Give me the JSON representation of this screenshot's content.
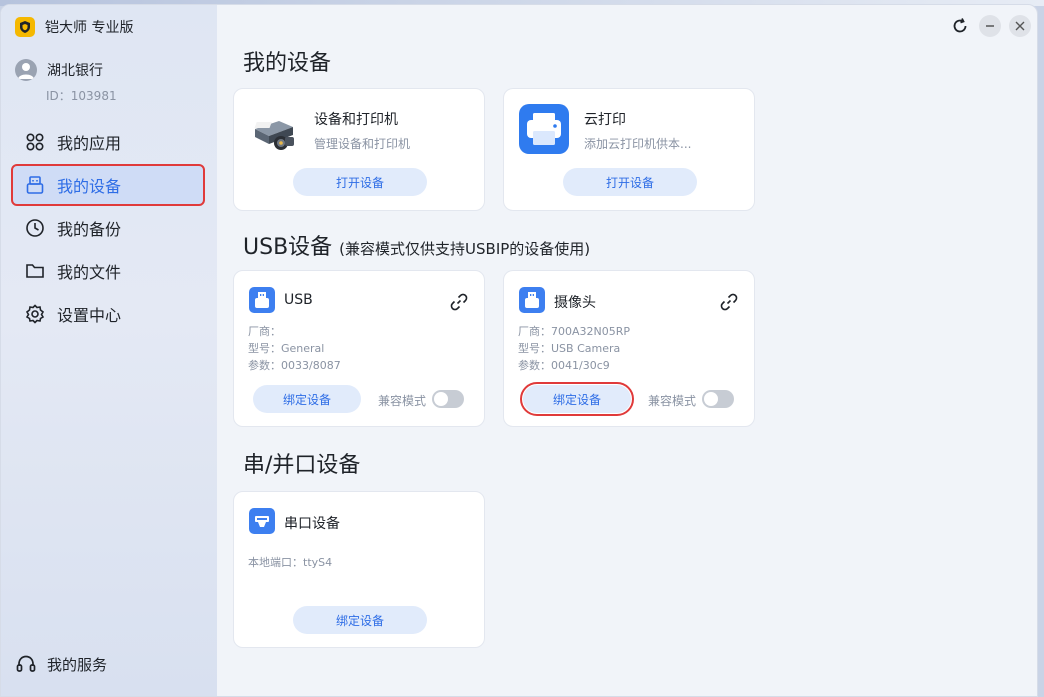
{
  "app": {
    "name": "铠大师 专业版"
  },
  "user": {
    "name": "湖北银行",
    "id": "ID：103981"
  },
  "sidebar": {
    "items": [
      {
        "label": "我的应用",
        "icon": "apps-icon"
      },
      {
        "label": "我的设备",
        "icon": "device-icon",
        "active": true
      },
      {
        "label": "我的备份",
        "icon": "clock-icon"
      },
      {
        "label": "我的文件",
        "icon": "folder-icon"
      },
      {
        "label": "设置中心",
        "icon": "gear-icon"
      }
    ],
    "service": "我的服务"
  },
  "sections": {
    "my_devices": "我的设备",
    "usb_title": "USB设备",
    "usb_subtitle": "(兼容模式仅供支持USBIP的设备使用)",
    "serial_title": "串/并口设备"
  },
  "my_devices": [
    {
      "title": "设备和打印机",
      "desc": "管理设备和打印机",
      "button": "打开设备"
    },
    {
      "title": "云打印",
      "desc": "添加云打印机供本...",
      "button": "打开设备"
    }
  ],
  "usb_devices": [
    {
      "name": "USB",
      "vendor": "厂商：",
      "model": "型号：General",
      "params": "参数：0033/8087",
      "button": "绑定设备",
      "compat_label": "兼容模式",
      "compat_on": false
    },
    {
      "name": "摄像头",
      "vendor": "厂商：700A32N05RP",
      "model": "型号：USB Camera",
      "params": "参数：0041/30c9",
      "button": "绑定设备",
      "compat_label": "兼容模式",
      "compat_on": false
    }
  ],
  "serial_devices": [
    {
      "name": "串口设备",
      "port": "本地端口：ttyS4",
      "button": "绑定设备"
    }
  ],
  "colors": {
    "accent": "#2e6de6",
    "highlight": "#e03a3a",
    "button_bg": "#e1ebfb"
  }
}
